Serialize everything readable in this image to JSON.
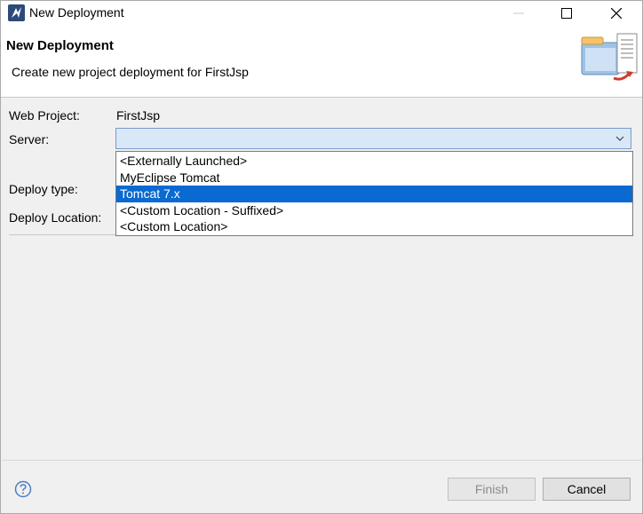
{
  "window": {
    "title": "New Deployment"
  },
  "banner": {
    "title": "New Deployment",
    "description": "Create new project deployment for FirstJsp"
  },
  "form": {
    "web_project_label": "Web Project:",
    "web_project_value": "FirstJsp",
    "server_label": "Server:",
    "server_value": "",
    "deploy_type_label": "Deploy type:",
    "deploy_location_label": "Deploy Location:"
  },
  "server_dropdown": {
    "options": [
      "<Externally Launched>",
      "MyEclipse Tomcat",
      "Tomcat  7.x",
      "<Custom Location - Suffixed>",
      "<Custom Location>"
    ],
    "highlighted": "Tomcat  7.x"
  },
  "footer": {
    "finish_label": "Finish",
    "cancel_label": "Cancel"
  },
  "colors": {
    "selection": "#0a6ad2",
    "combo_fill": "#d8e8f8",
    "dialog_bg": "#f0f0f0"
  },
  "icons": {
    "app": "myeclipse-app-icon",
    "banner": "deployment-wizard-image",
    "help": "help-icon",
    "dropdown": "chevron-down-icon"
  }
}
